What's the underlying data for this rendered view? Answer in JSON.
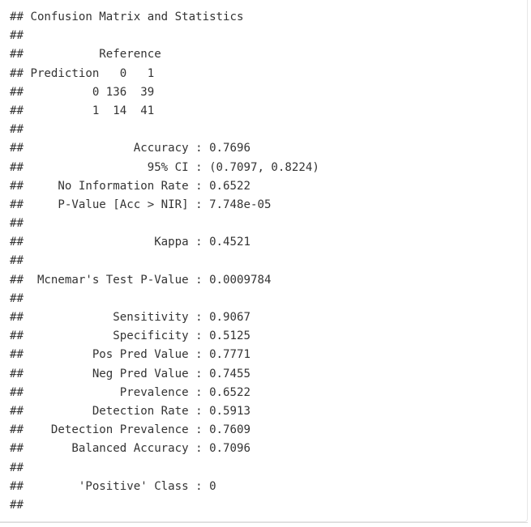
{
  "output": {
    "lines": [
      "## Confusion Matrix and Statistics",
      "##",
      "##           Reference",
      "## Prediction   0   1",
      "##          0 136  39",
      "##          1  14  41",
      "##",
      "##                Accuracy : 0.7696",
      "##                  95% CI : (0.7097, 0.8224)",
      "##     No Information Rate : 0.6522",
      "##     P-Value [Acc > NIR] : 7.748e-05",
      "##",
      "##                   Kappa : 0.4521",
      "##",
      "##  Mcnemar's Test P-Value : 0.0009784",
      "##",
      "##             Sensitivity : 0.9067",
      "##             Specificity : 0.5125",
      "##          Pos Pred Value : 0.7771",
      "##          Neg Pred Value : 0.7455",
      "##              Prevalence : 0.6522",
      "##          Detection Rate : 0.5913",
      "##    Detection Prevalence : 0.7609",
      "##       Balanced Accuracy : 0.7096",
      "##",
      "##        'Positive' Class : 0",
      "##"
    ]
  }
}
